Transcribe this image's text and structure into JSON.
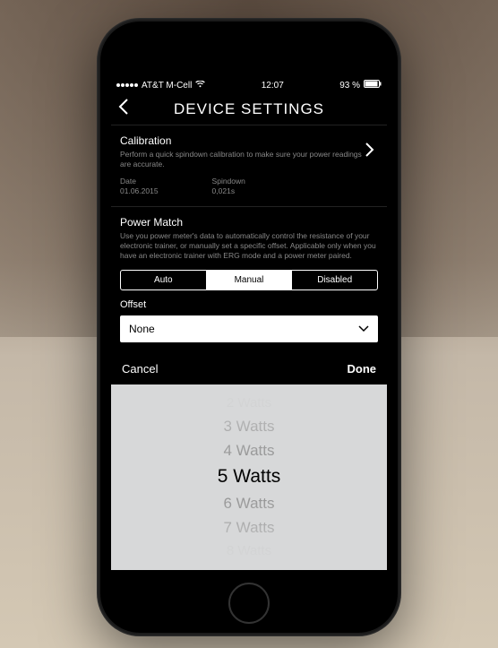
{
  "status_bar": {
    "carrier": "AT&T M-Cell",
    "time": "12:07",
    "battery": "93 %"
  },
  "navbar": {
    "title": "DEVICE SETTINGS"
  },
  "calibration": {
    "title": "Calibration",
    "description": "Perform a quick spindown calibration to make sure your power readings are accurate.",
    "date_label": "Date",
    "date_value": "01.06.2015",
    "spindown_label": "Spindown",
    "spindown_value": "0,021s"
  },
  "power_match": {
    "title": "Power Match",
    "description": "Use you power meter's data to automatically control the resistance of your electronic trainer, or manually set a specific offset.  Applicable only when you have an electronic trainer with ERG mode and a power meter paired.",
    "segments": {
      "auto": "Auto",
      "manual": "Manual",
      "disabled": "Disabled"
    },
    "offset_label": "Offset",
    "offset_value": "None"
  },
  "picker": {
    "cancel": "Cancel",
    "done": "Done",
    "items": [
      "2 Watts",
      "3 Watts",
      "4 Watts",
      "5 Watts",
      "6 Watts",
      "7 Watts",
      "8 Watts"
    ],
    "selected": "5 Watts"
  }
}
